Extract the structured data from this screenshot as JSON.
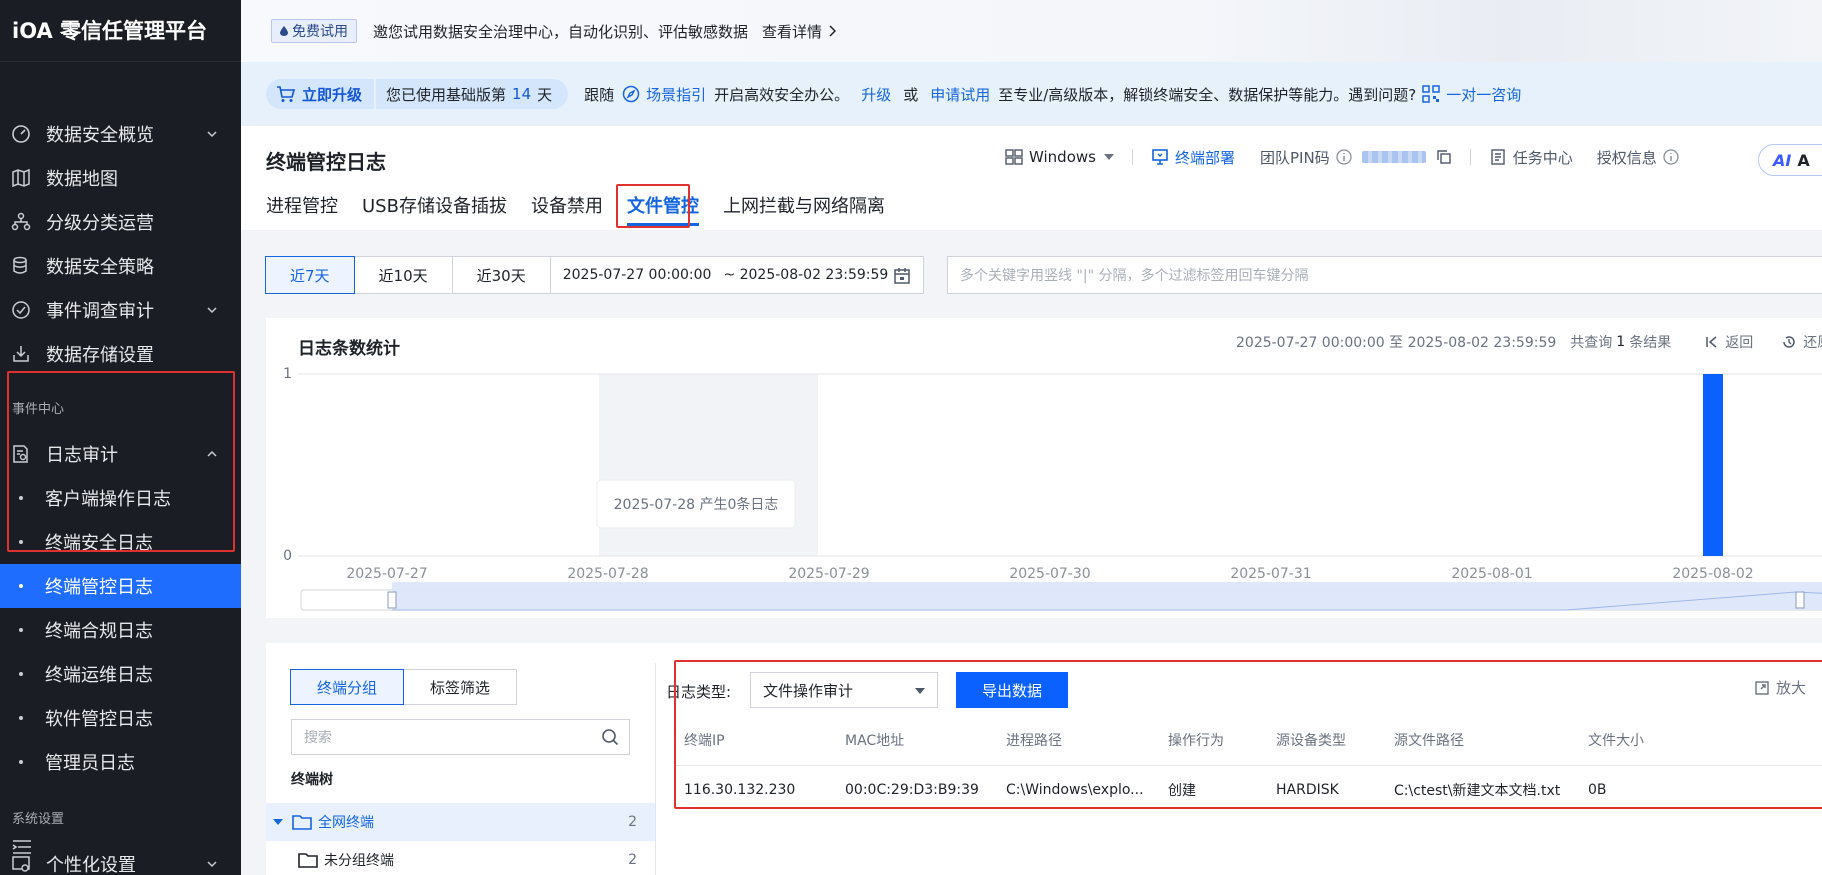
{
  "app": {
    "title": "iOA 零信任管理平台"
  },
  "sidebar": {
    "items": [
      {
        "label": "数据安全概览",
        "icon": "dashboard-icon"
      },
      {
        "label": "数据地图",
        "icon": "map-icon"
      },
      {
        "label": "分级分类运营",
        "icon": "hierarchy-icon"
      },
      {
        "label": "数据安全策略",
        "icon": "database-icon"
      },
      {
        "label": "事件调查审计",
        "icon": "audit-icon"
      },
      {
        "label": "数据存储设置",
        "icon": "storage-icon"
      }
    ],
    "group_event": "事件中心",
    "log_audit": {
      "label": "日志审计",
      "icon": "log-audit-icon"
    },
    "sub_items": [
      "客户端操作日志",
      "终端安全日志",
      "终端管控日志",
      "终端合规日志",
      "终端运维日志",
      "软件管控日志",
      "管理员日志"
    ],
    "active_sub": 2,
    "group_system": "系统设置",
    "personal": {
      "label": "个性化设置",
      "icon": "settings-icon"
    }
  },
  "banner": {
    "tag": "免费试用",
    "text": "邀您试用数据安全治理中心，自动化识别、评估敏感数据",
    "link": "查看详情"
  },
  "upgrade": {
    "button": "立即升级",
    "used_prefix": "您已使用基础版第",
    "used_days": "14",
    "used_suffix": "天",
    "t1": "跟随",
    "guide": "场景指引",
    "t2": "开启高效安全办公。",
    "upgrade_link": "升级",
    "or": "或",
    "apply_link": "申请试用",
    "t3": "至专业/高级版本，解锁终端安全、数据保护等能力。遇到问题?",
    "consult": "一对一咨询"
  },
  "header": {
    "title": "终端管控日志",
    "os": "Windows",
    "deploy": "终端部署",
    "pin_label": "团队PIN码",
    "task_center": "任务中心",
    "license": "授权信息",
    "ai_label": "AI",
    "ai_letter": "A"
  },
  "tabs": [
    "进程管控",
    "USB存储设备插拔",
    "设备禁用",
    "文件管控",
    "上网拦截与网络隔离"
  ],
  "active_tab": 3,
  "filters": {
    "ranges": [
      "近7天",
      "近10天",
      "近30天"
    ],
    "start": "2025-07-27 00:00:00",
    "end": "~ 2025-08-02 23:59:59",
    "keyword_placeholder": "多个关键字用竖线 \"|\" 分隔，多个过滤标签用回车键分隔"
  },
  "chart_data": {
    "type": "bar",
    "title": "日志条数统计",
    "categories": [
      "2025-07-27",
      "2025-07-28",
      "2025-07-29",
      "2025-07-30",
      "2025-07-31",
      "2025-08-01",
      "2025-08-02"
    ],
    "values": [
      0,
      0,
      0,
      0,
      0,
      0,
      1
    ],
    "ylim": [
      0,
      1
    ],
    "yticks": [
      "0",
      "1"
    ],
    "tooltip": "2025-07-28 产生0条日志",
    "highlight_category": "2025-07-28",
    "bar_color": "#0b61ff",
    "meta": {
      "range_text": "2025-07-27 00:00:00 至 2025-08-02 23:59:59",
      "result_prefix": "共查询",
      "result_count": "1",
      "result_suffix": "条结果",
      "back": "返回",
      "restore": "还原"
    }
  },
  "tree": {
    "tabs": [
      "终端分组",
      "标签筛选"
    ],
    "search_placeholder": "搜索",
    "label": "终端树",
    "nodes": [
      {
        "name": "全网终端",
        "count": "2"
      },
      {
        "name": "未分组终端",
        "count": "2"
      }
    ]
  },
  "log": {
    "type_label": "日志类型:",
    "type_value": "文件操作审计",
    "export": "导出数据",
    "zoom": "放大",
    "columns": [
      "终端IP",
      "MAC地址",
      "进程路径",
      "操作行为",
      "源设备类型",
      "源文件路径",
      "文件大小"
    ],
    "rows": [
      [
        "116.30.132.230",
        "00:0C:29:D3:B9:39",
        "C:\\Windows\\explo...",
        "创建",
        "HARDISK",
        "C:\\ctest\\新建文本文档.txt",
        "0B"
      ]
    ]
  },
  "colors": {
    "accent": "#1565e0",
    "sidebar_bg": "#1a1d24",
    "active_bg": "#1f6dff",
    "highlight_box": "#e03131"
  }
}
